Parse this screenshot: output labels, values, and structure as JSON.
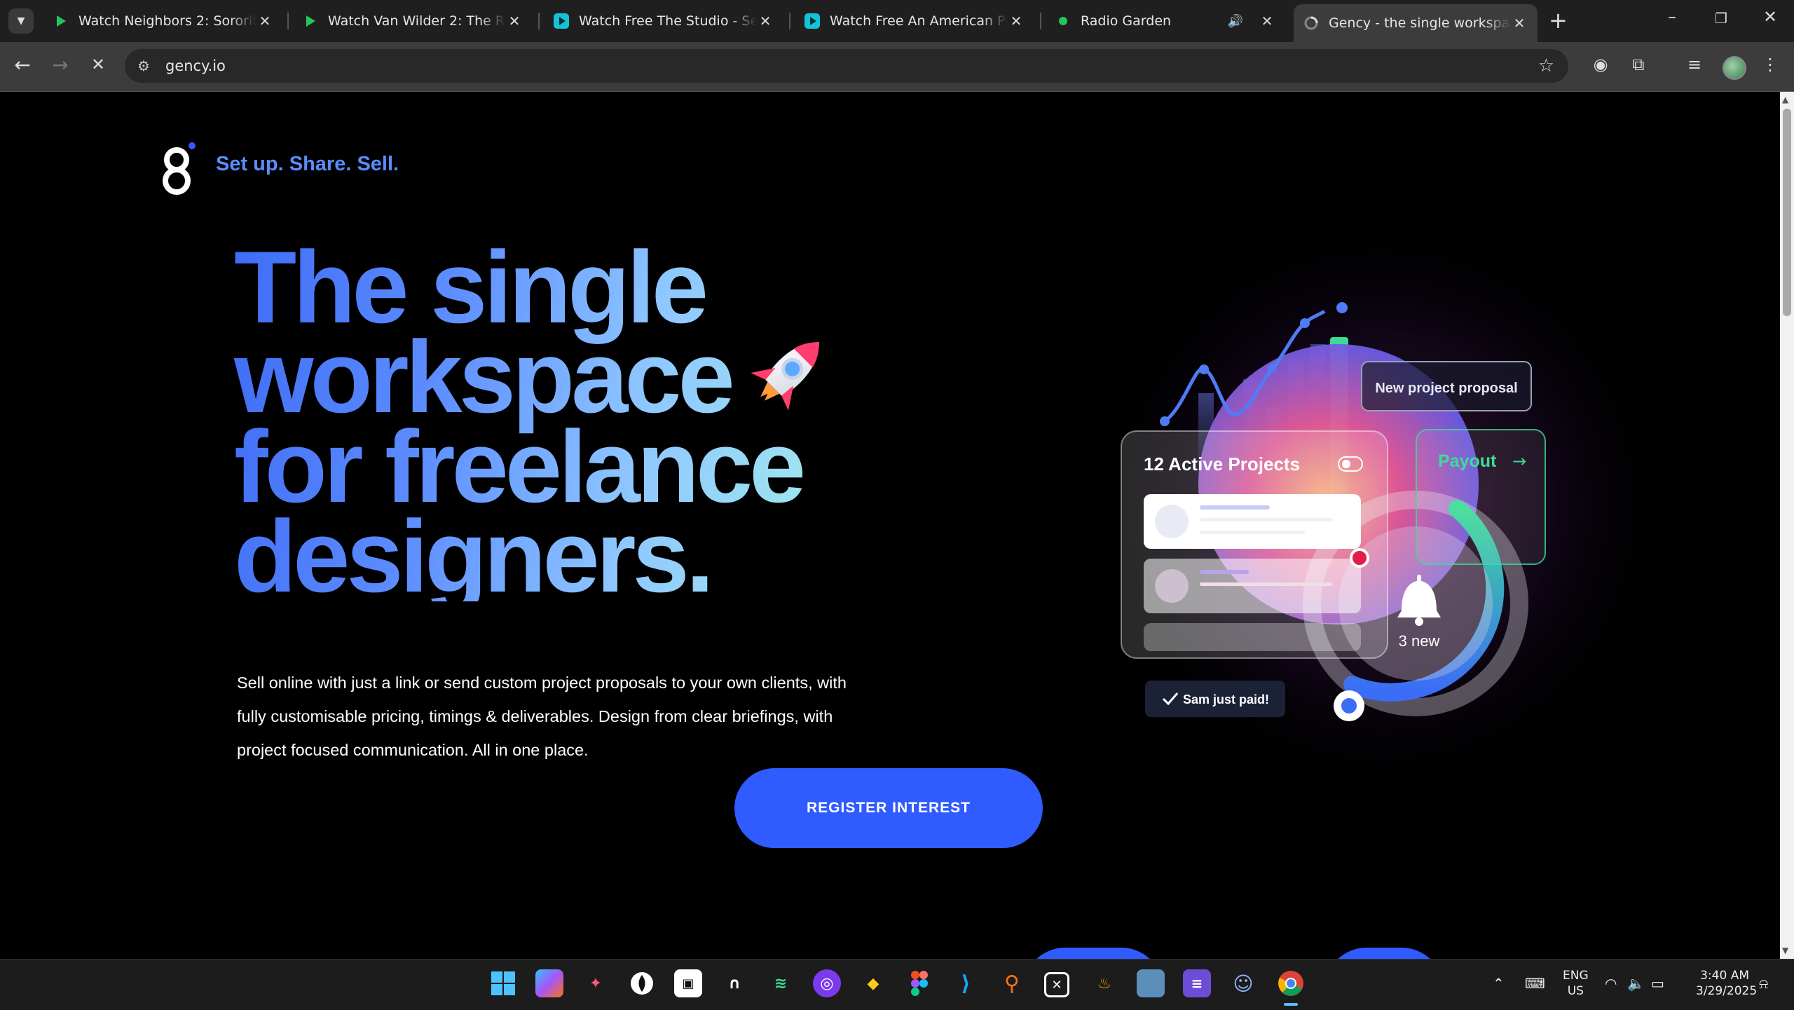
{
  "browser": {
    "tabs": [
      {
        "title": "Watch Neighbors 2: Sorority Rising",
        "icon": "play-green-icon"
      },
      {
        "title": "Watch Van Wilder 2: The Rise of Taj",
        "icon": "play-green-icon"
      },
      {
        "title": "Watch Free The Studio - Season 1",
        "icon": "play-cyan-icon"
      },
      {
        "title": "Watch Free An American Pickle",
        "icon": "play-cyan-icon"
      },
      {
        "title": "Radio Garden",
        "icon": "green-dot-icon",
        "audio": true
      },
      {
        "title": "Gency - the single workspace for freelance designers",
        "icon": "loading-icon",
        "active": true
      }
    ],
    "url": "gency.io"
  },
  "page": {
    "tagline": "Set up. Share. Sell.",
    "headline": [
      "The single",
      "workspace",
      "for freelance",
      "designers."
    ],
    "subtext": "Sell online with just a link or send custom project proposals to your own clients, with fully customisable pricing, timings & deliverables. Design from clear briefings, with project focused communication. All in one place.",
    "cta_label": "REGISTER INTEREST",
    "illustration": {
      "proposal_label": "New project proposal",
      "projects_label": "12 Active Projects",
      "payout_label": "Payout",
      "notifications_label": "3 new",
      "paid_label": "Sam just paid!"
    }
  },
  "taskbar": {
    "language": "ENG",
    "region": "US",
    "time": "3:40 AM",
    "date": "3/29/2025"
  },
  "colors": {
    "accent": "#2f5bff",
    "tagline": "#5b8cff",
    "payout": "#3ddc97"
  }
}
